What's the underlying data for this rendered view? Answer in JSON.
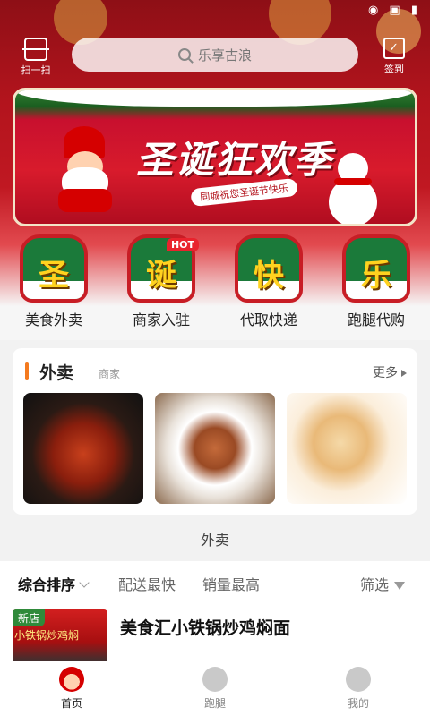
{
  "header": {
    "scan_label": "扫一扫",
    "checkin_label": "签到",
    "search_placeholder": "乐享古浪"
  },
  "banner": {
    "title": "圣诞狂欢季",
    "subtitle": "同城祝您圣诞节快乐"
  },
  "categories": [
    {
      "badge_char": "圣",
      "label": "美食外卖"
    },
    {
      "badge_char": "诞",
      "label": "商家入驻",
      "tag": "HOT"
    },
    {
      "badge_char": "快",
      "label": "代取快递"
    },
    {
      "badge_char": "乐",
      "label": "跑腿代购"
    }
  ],
  "takeaway": {
    "title": "外卖",
    "subtitle": "商家",
    "more_label": "更多",
    "caption": "外卖"
  },
  "sort": {
    "comprehensive": "综合排序",
    "fastest": "配送最快",
    "top_sales": "销量最高",
    "filter": "筛选"
  },
  "store": {
    "tag": "新店",
    "sign": "小铁锅炒鸡焖",
    "name": "美食汇小铁锅炒鸡焖面"
  },
  "nav": [
    {
      "label": "首页",
      "active": true
    },
    {
      "label": "跑腿",
      "active": false
    },
    {
      "label": "我的",
      "active": false
    }
  ],
  "colors": {
    "header_red": "#c01822",
    "accent_orange": "#f47a1f",
    "badge_green": "#1b7a3a",
    "hot_red": "#e9232d"
  }
}
